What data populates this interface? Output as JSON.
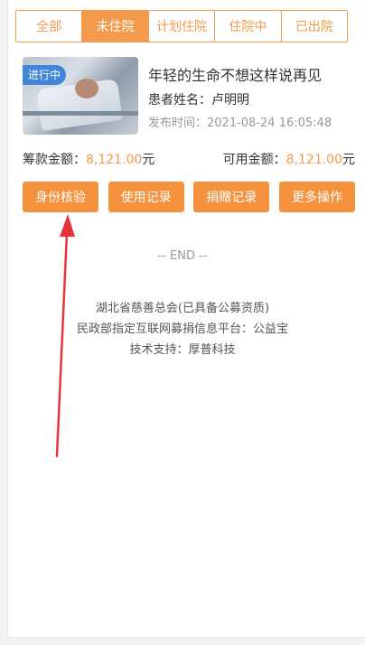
{
  "tabs": [
    {
      "label": "全部",
      "active": false
    },
    {
      "label": "未住院",
      "active": true
    },
    {
      "label": "计划住院",
      "active": false
    },
    {
      "label": "住院中",
      "active": false
    },
    {
      "label": "已出院",
      "active": false
    }
  ],
  "card": {
    "status_badge": "进行中",
    "title": "年轻的生命不想这样说再见",
    "patient_label": "患者姓名：",
    "patient_name": "卢明明",
    "publish_label": "发布时间：",
    "publish_time": "2021-08-24 16:05:48"
  },
  "amounts": {
    "raised_label": "筹款金额：",
    "raised_value": "8,121.00",
    "raised_unit": "元",
    "available_label": "可用金额：",
    "available_value": "8,121.00",
    "available_unit": "元"
  },
  "actions": {
    "verify": "身份核验",
    "usage": "使用记录",
    "donations": "捐赠记录",
    "more": "更多操作"
  },
  "end_text": "-- END --",
  "footer": {
    "line1": "湖北省慈善总会(已具备公募资质)",
    "line2": "民政部指定互联网募捐信息平台：公益宝",
    "line3": "技术支持：厚普科技"
  },
  "colors": {
    "accent": "#f39a4c",
    "badge": "#3f86d6",
    "annotation_arrow": "#e8333d"
  }
}
